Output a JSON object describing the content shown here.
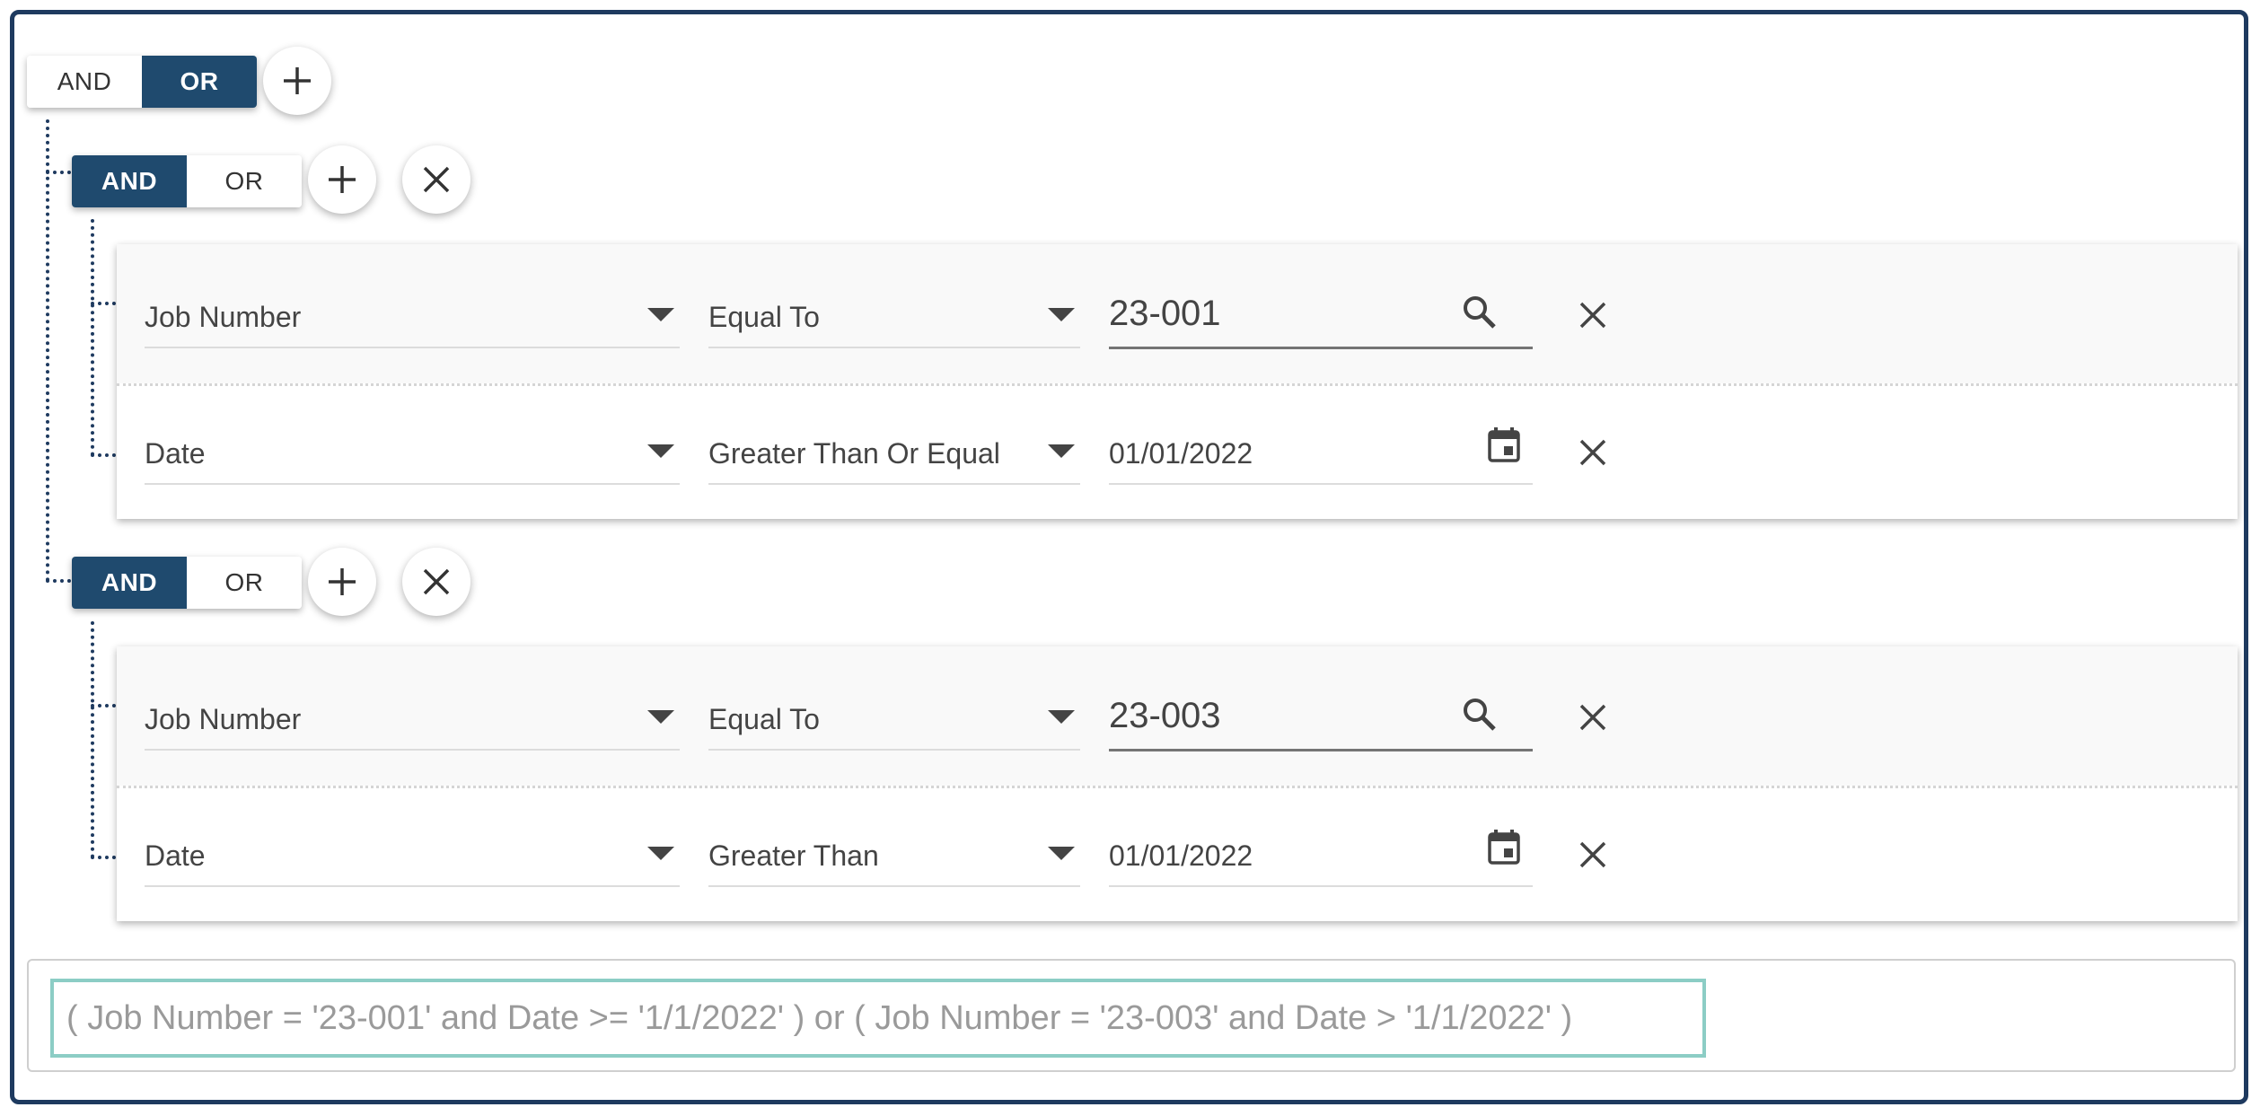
{
  "root": {
    "toggle": {
      "and_label": "AND",
      "or_label": "OR",
      "active": "OR"
    }
  },
  "groups": [
    {
      "toggle": {
        "and_label": "AND",
        "or_label": "OR",
        "active": "AND"
      },
      "rules": [
        {
          "field": "Job Number",
          "operator": "Equal To",
          "value": "23-001",
          "value_icon": "search-icon"
        },
        {
          "field": "Date",
          "operator": "Greater Than Or Equal",
          "value": "01/01/2022",
          "value_icon": "calendar-icon"
        }
      ]
    },
    {
      "toggle": {
        "and_label": "AND",
        "or_label": "OR",
        "active": "AND"
      },
      "rules": [
        {
          "field": "Job Number",
          "operator": "Equal To",
          "value": "23-003",
          "value_icon": "search-icon"
        },
        {
          "field": "Date",
          "operator": "Greater Than",
          "value": "01/01/2022",
          "value_icon": "calendar-icon"
        }
      ]
    }
  ],
  "expression": "( Job Number = '23-001' and Date >= '1/1/2022' ) or ( Job Number = '23-003' and Date > '1/1/2022' )",
  "colors": {
    "primary": "#1f4a6e",
    "border": "#1e3a5f",
    "highlight": "#8ccdc5"
  }
}
